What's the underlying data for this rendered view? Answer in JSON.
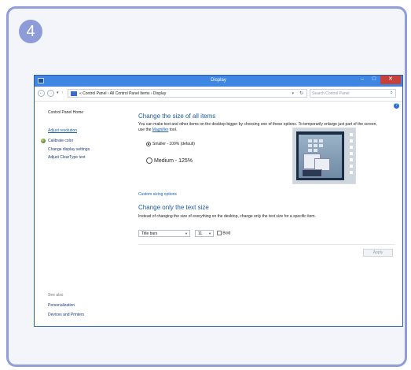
{
  "step_number": "4",
  "window": {
    "title": "Display",
    "controls": {
      "minimize": "–",
      "maximize": "□",
      "close": "✕"
    }
  },
  "address_bar": {
    "back": "←",
    "forward": "→",
    "recent": "▾",
    "up": "↑",
    "breadcrumb": "« Control Panel  ›  All Control Panel Items  ›  Display",
    "dropdown": "▾",
    "refresh": "↻"
  },
  "search": {
    "placeholder": "Search Control Panel",
    "icon": "⌕"
  },
  "help": "?",
  "sidebar": {
    "home": "Control Panel Home",
    "links": [
      "Adjust resolution",
      "Calibrate color",
      "Change display settings",
      "Adjust ClearType text"
    ],
    "see_also_heading": "See also",
    "see_also": [
      "Personalization",
      "Devices and Printers"
    ]
  },
  "content": {
    "heading1": "Change the size of all items",
    "desc1_part1": "You can make text and other items on the desktop bigger by choosing one of these options. To temporarily enlarge just part of the screen, use the ",
    "desc1_link": "Magnifier",
    "desc1_part2": " tool.",
    "option_smaller": "Smaller - 100% (default)",
    "option_medium": "Medium - 125%",
    "custom_link": "Custom sizing options",
    "heading2": "Change only the text size",
    "desc2": "Instead of changing the size of everything on the desktop, change only the text size for a specific item.",
    "item_select": "Title bars",
    "size_select": "11",
    "bold_label": "Bold",
    "apply": "Apply"
  },
  "colors": {
    "frame_border": "#8f9ed8",
    "badge": "#8d9bd8",
    "titlebar": "#3f86e3",
    "close_button": "#c7403a",
    "link": "#1a5fb4",
    "heading": "#1d5aa0"
  },
  "icons": [
    "window-app-icon",
    "back-arrow-icon",
    "forward-arrow-icon",
    "folder-icon",
    "refresh-icon",
    "search-icon",
    "help-icon",
    "color-calibrate-icon",
    "display-preview-icon"
  ]
}
